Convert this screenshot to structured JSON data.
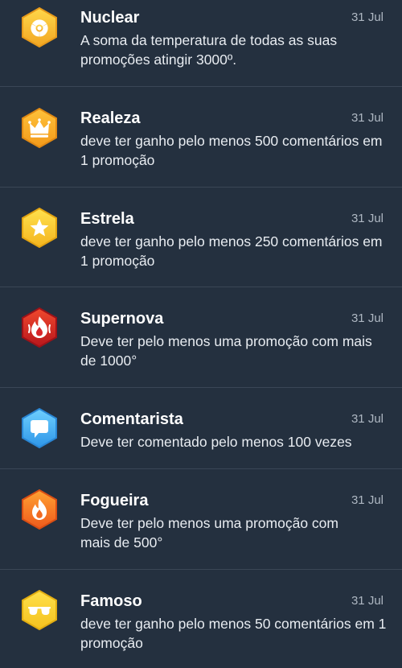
{
  "achievements": [
    {
      "title": "Nuclear",
      "date": "31 Jul",
      "description": "A soma da temperatura de todas as suas promoções atingir 3000º.",
      "icon": "radiation-icon",
      "colors": {
        "top": "#ffd84a",
        "bottom": "#f2a623"
      }
    },
    {
      "title": "Realeza",
      "date": "31 Jul",
      "description": "deve ter ganho pelo menos 500 comentários em 1 promoção",
      "icon": "crown-icon",
      "colors": {
        "top": "#ffc23a",
        "bottom": "#f39a1a"
      }
    },
    {
      "title": "Estrela",
      "date": "31 Jul",
      "description": "deve ter ganho pelo menos 250 comentários em 1 promoção",
      "icon": "star-icon",
      "colors": {
        "top": "#ffe14d",
        "bottom": "#f4b51f"
      }
    },
    {
      "title": "Supernova",
      "date": "31 Jul",
      "description": "Deve ter pelo menos uma promoção com mais de 1000°",
      "icon": "supernova-flame-icon",
      "colors": {
        "top": "#f0492e",
        "bottom": "#b8161c"
      }
    },
    {
      "title": "Comentarista",
      "date": "31 Jul",
      "description": "Deve ter comentado pelo menos 100 vezes",
      "icon": "comment-bubble-icon",
      "colors": {
        "top": "#6fd0ff",
        "bottom": "#2e96e8"
      }
    },
    {
      "title": "Fogueira",
      "date": "31 Jul",
      "description": "Deve ter pelo menos uma promoção com mais de 500°",
      "icon": "flame-icon",
      "colors": {
        "top": "#ffa233",
        "bottom": "#ef5a1c"
      }
    },
    {
      "title": "Famoso",
      "date": "31 Jul",
      "description": "deve ter ganho pelo menos 50 comentários em 1 promoção",
      "icon": "sunglasses-icon",
      "colors": {
        "top": "#ffe04a",
        "bottom": "#f4c21f"
      }
    }
  ]
}
